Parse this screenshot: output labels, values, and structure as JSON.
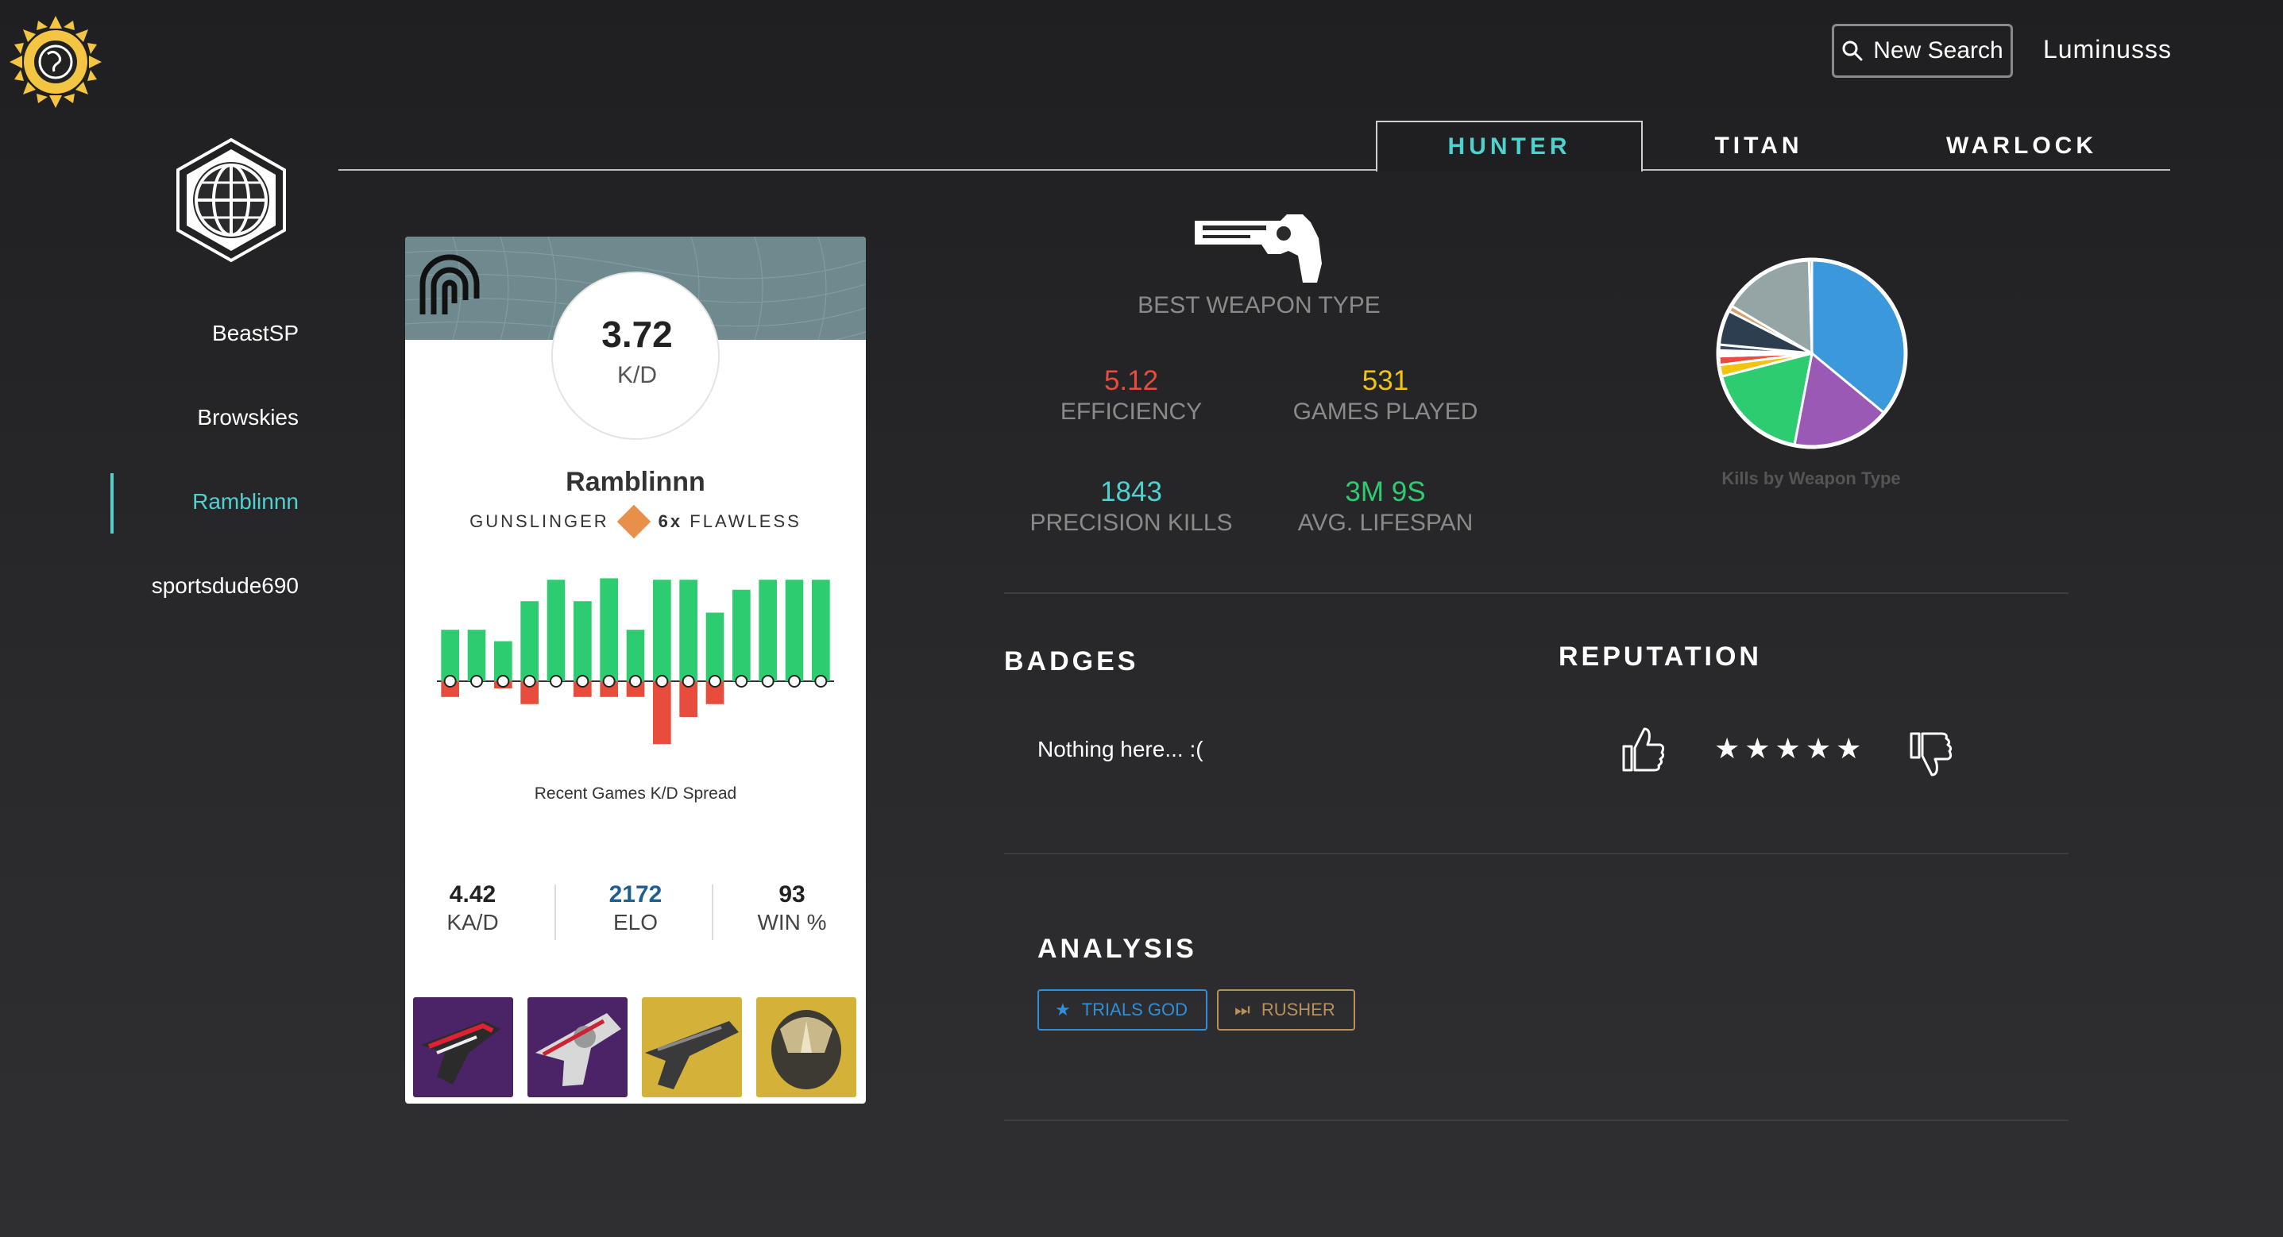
{
  "header": {
    "new_search_label": "New Search",
    "username": "Luminusss"
  },
  "sidebar": {
    "items": [
      {
        "label": "BeastSP",
        "active": false
      },
      {
        "label": "Browskies",
        "active": false
      },
      {
        "label": "Ramblinnn",
        "active": true
      },
      {
        "label": "sportsdude690",
        "active": false
      }
    ]
  },
  "tabs": [
    {
      "label": "HUNTER",
      "active": true
    },
    {
      "label": "TITAN",
      "active": false
    },
    {
      "label": "WARLOCK",
      "active": false
    }
  ],
  "card": {
    "kd_value": "3.72",
    "kd_label": "K/D",
    "player_name": "Ramblinnn",
    "subclass": "GUNSLINGER",
    "flawless_count": "6x",
    "flawless_label": "FLAWLESS",
    "spread_caption": "Recent Games K/D Spread",
    "stats": [
      {
        "value": "4.42",
        "label": "KA/D"
      },
      {
        "value": "2172",
        "label": "ELO"
      },
      {
        "value": "93",
        "label": "WIN %"
      }
    ]
  },
  "chart_data": [
    {
      "type": "bar",
      "title": "Recent Games K/D Spread",
      "categories": [
        "1",
        "2",
        "3",
        "4",
        "5",
        "6",
        "7",
        "8",
        "9",
        "10",
        "11",
        "12",
        "13",
        "14",
        "15"
      ],
      "series": [
        {
          "name": "kills",
          "values": [
            3.6,
            3.6,
            2.8,
            5.6,
            7.1,
            5.6,
            7.2,
            3.6,
            7.1,
            7.1,
            4.8,
            6.4,
            7.1,
            7.1,
            7.1
          ]
        },
        {
          "name": "deaths",
          "values": [
            1.1,
            0,
            0.5,
            1.6,
            0,
            1.1,
            1.1,
            1.1,
            4.4,
            2.5,
            1.6,
            0,
            0,
            0,
            0
          ]
        }
      ],
      "colors": [
        "#2ecc71",
        "#e74c3c"
      ]
    },
    {
      "type": "pie",
      "title": "Kills by Weapon Type",
      "values": [
        36,
        17,
        18,
        2,
        1.5,
        1,
        1,
        6,
        1,
        16,
        0.5
      ],
      "colors": [
        "#3a98db",
        "#9b59b6",
        "#2ecc71",
        "#f1c40f",
        "#e74c3c",
        "#ffffff",
        "#34495e",
        "#2c3e50",
        "#d9a06b",
        "#95a5a6",
        "#e67e22"
      ]
    }
  ],
  "weapon": {
    "best_weapon_label": "BEST WEAPON TYPE"
  },
  "metrics": [
    {
      "value": "5.12",
      "label": "EFFICIENCY",
      "color": "#e74c3c"
    },
    {
      "value": "531",
      "label": "GAMES PLAYED",
      "color": "#f1c40f"
    },
    {
      "value": "1843",
      "label": "PRECISION KILLS",
      "color": "#4fd1cf"
    },
    {
      "value": "3M 9S",
      "label": "AVG. LIFESPAN",
      "color": "#2ecc71"
    }
  ],
  "badges": {
    "title": "BADGES",
    "empty_text": "Nothing here... :("
  },
  "reputation": {
    "title": "REPUTATION",
    "stars": "★★★★★"
  },
  "analysis": {
    "title": "ANALYSIS",
    "tags": [
      {
        "label": "TRIALS GOD",
        "icon": "star-icon",
        "color": "#2f8fd8"
      },
      {
        "label": "RUSHER",
        "icon": "fast-forward-icon",
        "color": "#b8905a"
      }
    ]
  }
}
